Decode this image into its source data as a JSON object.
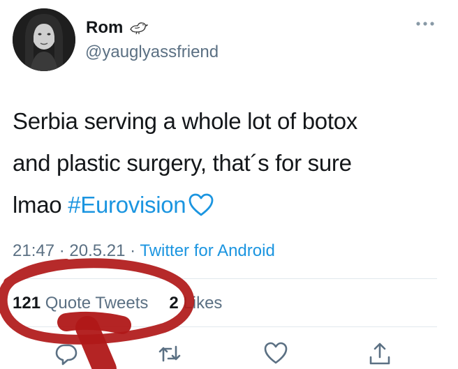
{
  "user": {
    "display_name": "Rom",
    "handle": "@yauglyassfriend"
  },
  "tweet": {
    "text_line1": "Serbia serving a whole lot of botox",
    "text_line2": "and plastic surgery, that´s for sure",
    "text_line3_prefix": "lmao ",
    "hashtag": "#Eurovision",
    "emoji": "light-blue-heart"
  },
  "meta": {
    "time": "21:47",
    "separator": " · ",
    "date": "20.5.21",
    "separator2": " · ",
    "source": "Twitter for Android"
  },
  "stats": {
    "quote_count": "121",
    "quote_label": " Quote Tweets",
    "likes_count": "2",
    "likes_label": " Likes"
  },
  "actions": [
    "reply-icon",
    "retweet-icon",
    "like-icon",
    "share-icon"
  ],
  "colors": {
    "link": "#1b95e0",
    "secondary_text": "#5b7083",
    "annotation": "#b01818"
  }
}
